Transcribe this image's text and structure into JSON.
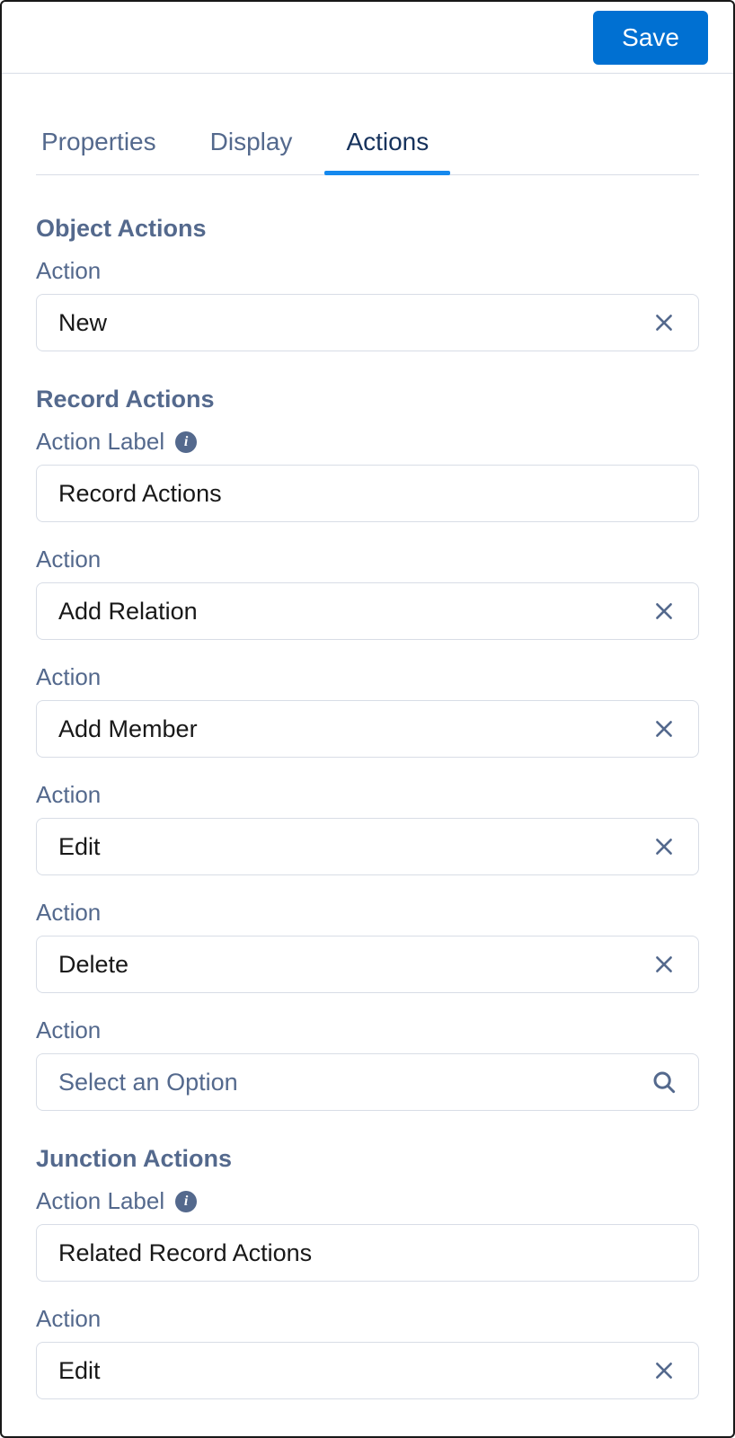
{
  "header": {
    "save": "Save"
  },
  "tabs": {
    "properties": "Properties",
    "display": "Display",
    "actions": "Actions"
  },
  "objectActions": {
    "title": "Object Actions",
    "fields": [
      {
        "label": "Action",
        "value": "New",
        "kind": "clear"
      }
    ]
  },
  "recordActions": {
    "title": "Record Actions",
    "actionLabel": {
      "label": "Action Label",
      "value": "Record Actions"
    },
    "fields": [
      {
        "label": "Action",
        "value": "Add Relation",
        "kind": "clear"
      },
      {
        "label": "Action",
        "value": "Add Member",
        "kind": "clear"
      },
      {
        "label": "Action",
        "value": "Edit",
        "kind": "clear"
      },
      {
        "label": "Action",
        "value": "Delete",
        "kind": "clear"
      },
      {
        "label": "Action",
        "value": "",
        "placeholder": "Select an Option",
        "kind": "search"
      }
    ]
  },
  "junctionActions": {
    "title": "Junction Actions",
    "actionLabel": {
      "label": "Action Label",
      "value": "Related Record Actions"
    },
    "fields": [
      {
        "label": "Action",
        "value": "Edit",
        "kind": "clear"
      }
    ]
  }
}
